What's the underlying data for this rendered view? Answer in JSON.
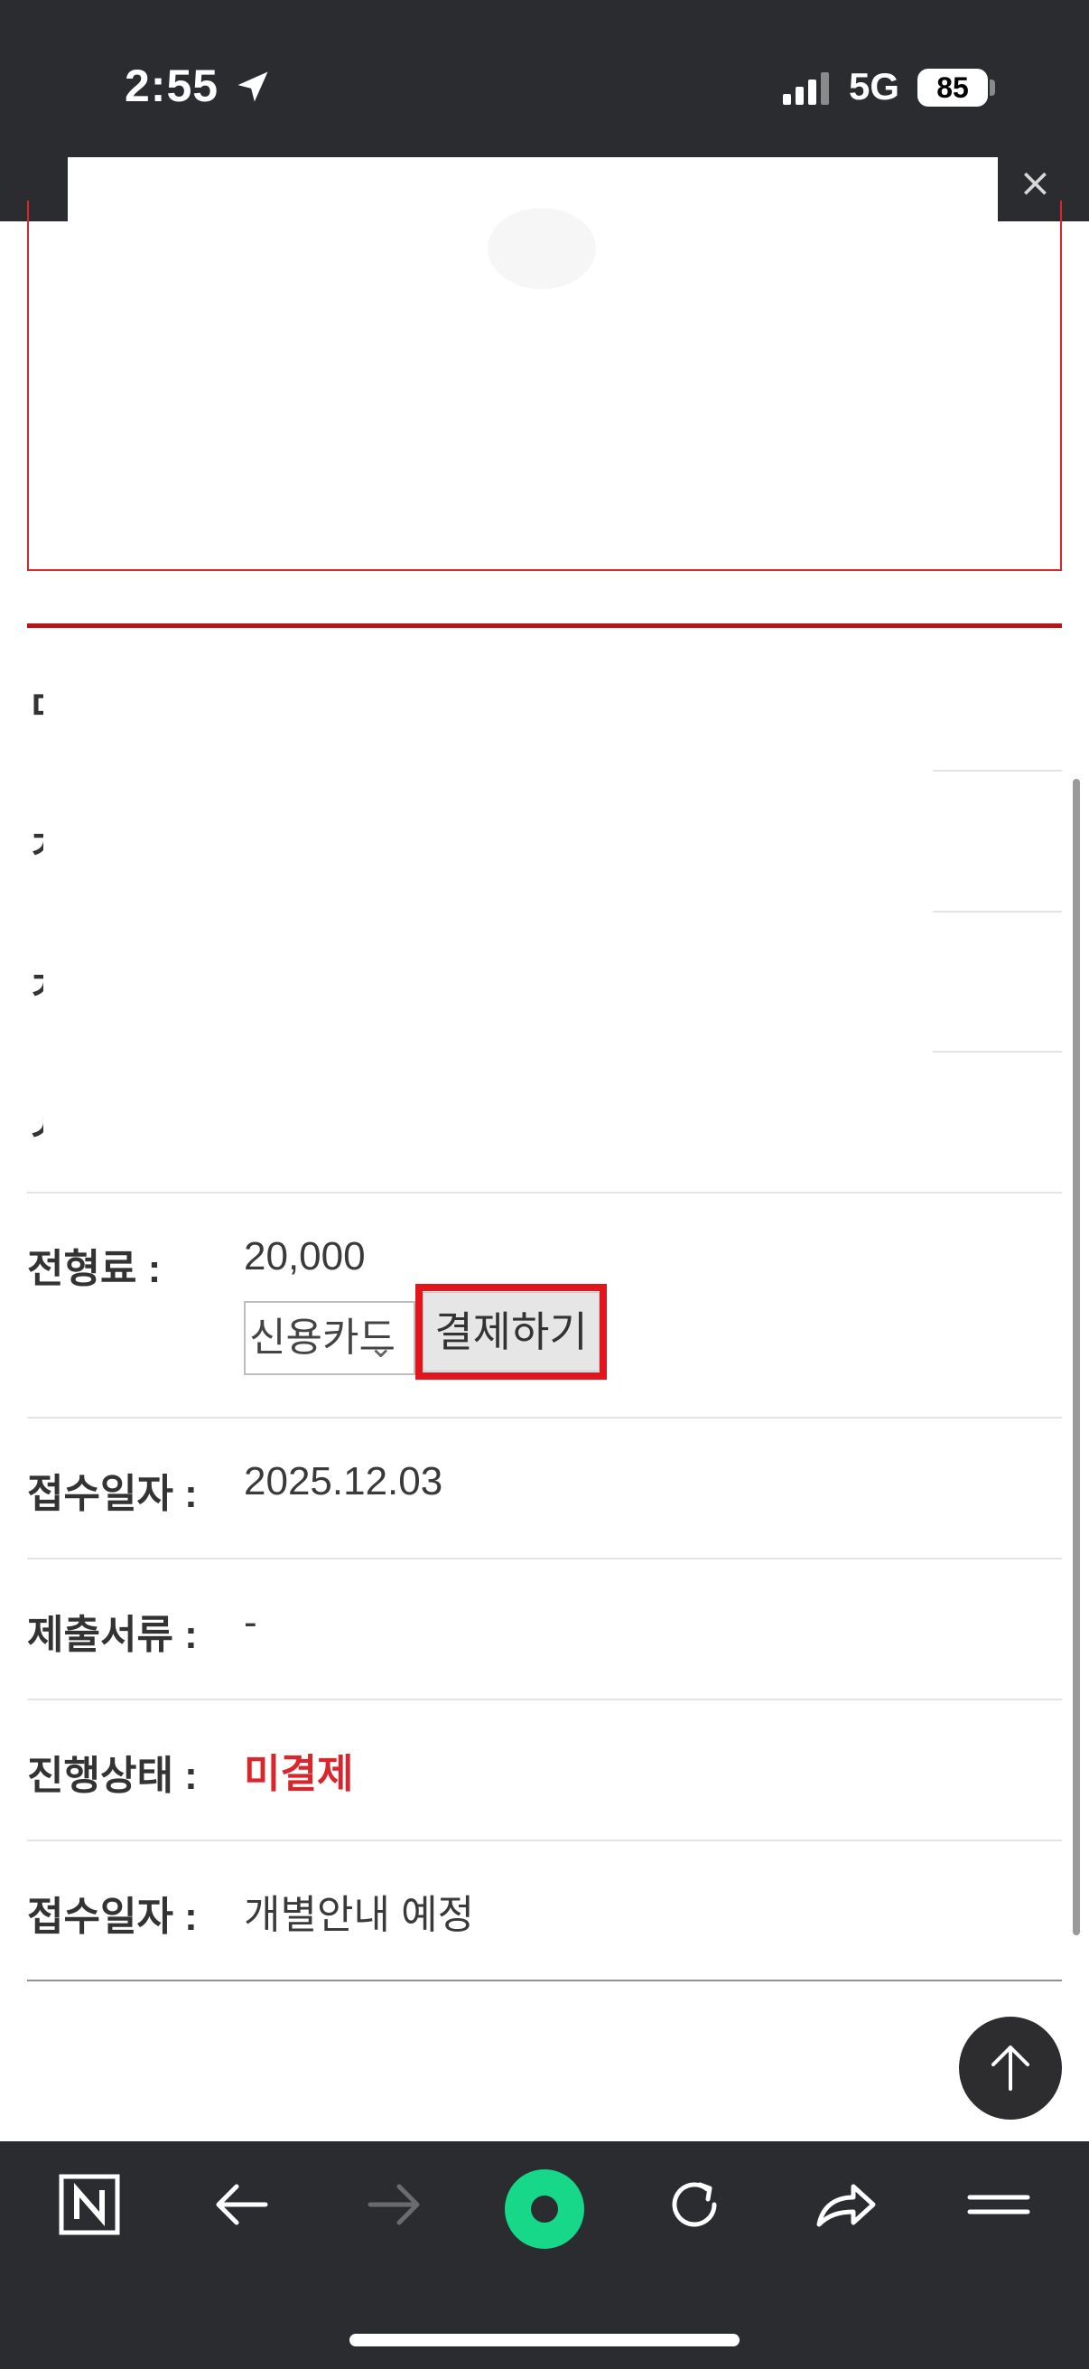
{
  "status_bar": {
    "time": "2:55",
    "network": "5G",
    "battery": "85",
    "icons": [
      "location-arrow-icon",
      "signal-bars-icon",
      "battery-icon"
    ]
  },
  "popup": {
    "close_label": "×"
  },
  "rows": [
    {
      "label": "전형료 :",
      "value": "20,000"
    },
    {
      "label": "접수일자 :",
      "value": "2025.12.03"
    },
    {
      "label": "제출서류 :",
      "value": "-"
    },
    {
      "label": "진행상태 :",
      "value": "미결제"
    },
    {
      "label": "접수일자 :",
      "value": "개별안내 예정"
    }
  ],
  "payment": {
    "method_selected": "신용카드",
    "pay_button": "결제하기"
  },
  "colors": {
    "accent_red": "#d9262c",
    "status_bar_bg": "#2b2c2f",
    "highlight_frame": "#e2151d"
  },
  "toolbar": {
    "icons": [
      "naver-n-icon",
      "back-arrow-icon",
      "forward-arrow-icon",
      "green-dot-icon",
      "refresh-icon",
      "share-icon",
      "menu-icon"
    ]
  }
}
